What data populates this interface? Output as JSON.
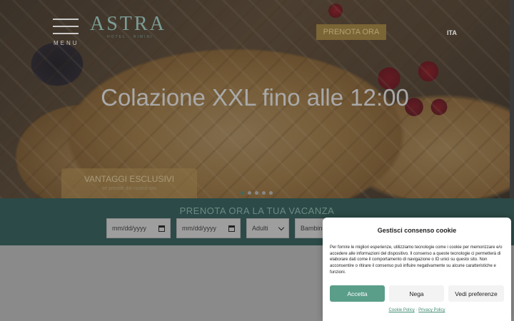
{
  "header": {
    "menu_label": "MENU",
    "logo_text": "ASTRA",
    "logo_subtitle": "HOTEL · RIMINI",
    "cta_label": "PRENOTA ORA",
    "language": "ITA"
  },
  "hero": {
    "title": "Colazione XXL fino alle 12:00",
    "vantaggi_title": "VANTAGGI ESCLUSIVI",
    "vantaggi_subtitle": "se prenoti dal nostro sito",
    "slides_count": 5,
    "active_slide": 1
  },
  "booking": {
    "title": "PRENOTA ORA LA TUA VACANZA",
    "checkin_placeholder": "mm/dd/yyyy",
    "checkout_placeholder": "mm/dd/yyyy",
    "adults_label": "Adulti",
    "children_label": "Bambini"
  },
  "cookie": {
    "title": "Gestisci consenso cookie",
    "text": "Per fornire le migliori esperienze, utilizziamo tecnologie come i cookie per memorizzare e/o accedere alle informazioni del dispositivo. Il consenso a queste tecnologie ci permetterà di elaborare dati come il comportamento di navigazione o ID unici su questo sito. Non acconsentire o ritirare il consenso può influire negativamente su alcune caratteristiche e funzioni.",
    "accept_label": "Accetta",
    "deny_label": "Nega",
    "prefs_label": "Vedi preferenze",
    "cookie_policy_label": "Cookie Policy",
    "privacy_policy_label": "Privacy Policy",
    "link_separator": "·"
  },
  "colors": {
    "booking_band": "#2c4a47",
    "accept_button": "#5a9e8a",
    "cta_gold": "#7a6536",
    "logo_teal": "#7a9d96"
  },
  "icons": {
    "menu": "hamburger-icon",
    "date": "calendar-icon",
    "select": "chevron-down-icon"
  }
}
